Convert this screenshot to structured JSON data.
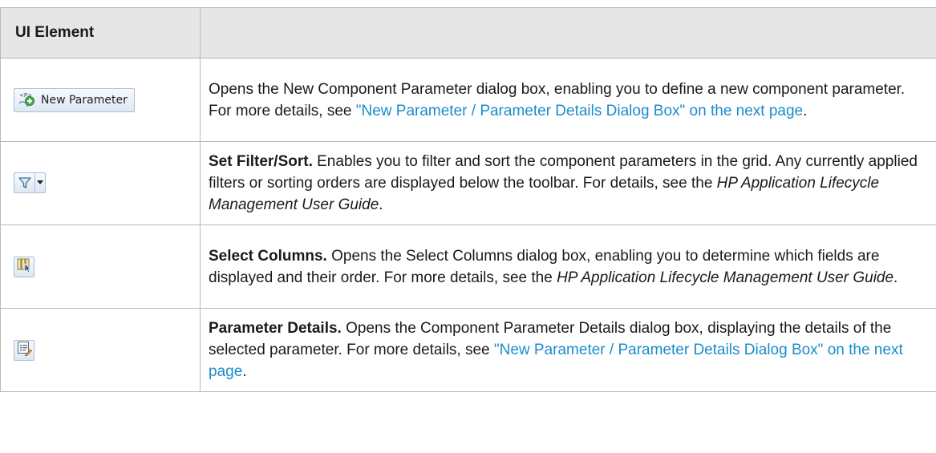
{
  "table": {
    "header": {
      "col1": "UI Element",
      "col2": ""
    },
    "rows": {
      "0": {
        "button_label": "New Parameter",
        "icon": "new-parameter-icon",
        "text": "Opens the New Component Parameter dialog box, enabling you to define a new component parameter. For more details, see ",
        "link": "\"New Parameter / Parameter Details Dialog Box\" on the next page",
        "end": "."
      },
      "1": {
        "icon": "filter-icon",
        "bold": "Set Filter/Sort.",
        "text": " Enables you to filter and sort the component parameters in the grid. Any currently applied filters or sorting orders are displayed below the toolbar. For details, see the ",
        "italic": "HP Application Lifecycle Management User Guide",
        "end": "."
      },
      "2": {
        "icon": "select-columns-icon",
        "bold": "Select Columns.",
        "text": " Opens the Select Columns dialog box, enabling you to determine which fields are displayed and their order. For more details, see the ",
        "italic": "HP Application Lifecycle Management User Guide",
        "end": "."
      },
      "3": {
        "icon": "parameter-details-icon",
        "bold": "Parameter Details.",
        "text": " Opens the Component Parameter Details dialog box, displaying the details of the selected parameter. For more details, see ",
        "link": "\"New Parameter / Parameter Details Dialog Box\" on the next page",
        "end": "."
      }
    }
  },
  "colors": {
    "link": "#1a8ccb",
    "header_bg": "#e6e6e6",
    "border": "#b9b9b9"
  }
}
